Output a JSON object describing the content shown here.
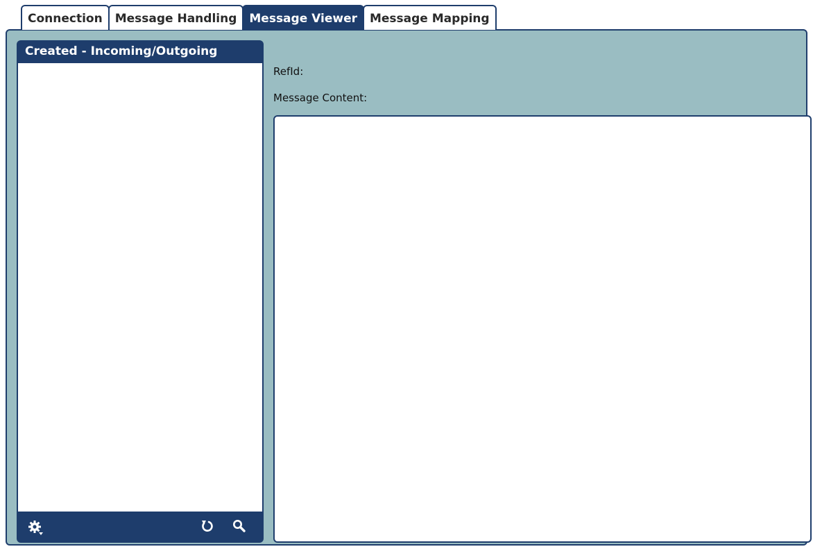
{
  "tabs": [
    {
      "label": "Connection",
      "active": false
    },
    {
      "label": "Message Handling",
      "active": false
    },
    {
      "label": "Message Viewer",
      "active": true
    },
    {
      "label": "Message Mapping",
      "active": false
    }
  ],
  "list_panel": {
    "title": "Created - Incoming/Outgoing",
    "items": [],
    "footer_icons": [
      "gear-icon",
      "refresh-icon",
      "search-icon"
    ]
  },
  "details": {
    "refid_label": "RefId:",
    "refid_value": "",
    "content_label": "Message Content:",
    "content_value": ""
  },
  "colors": {
    "accent": "#1e3d6c",
    "panel_background": "#9abdc2",
    "white": "#ffffff"
  }
}
